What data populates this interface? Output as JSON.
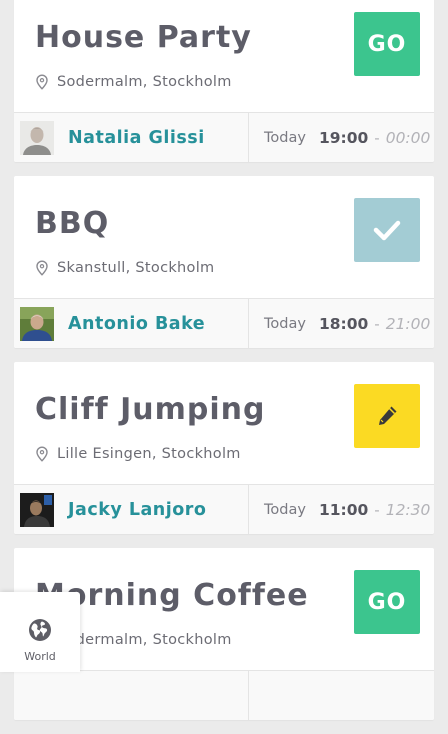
{
  "events": [
    {
      "title": "House Party",
      "location": "Sodermalm, Stockholm",
      "action": "go",
      "action_label": "GO",
      "host": "Natalia Glissi",
      "day": "Today",
      "start": "19:00",
      "separator": "-",
      "end": "00:00"
    },
    {
      "title": "BBQ",
      "location": "Skanstull, Stockholm",
      "action": "done",
      "action_label": "",
      "host": "Antonio Bake",
      "day": "Today",
      "start": "18:00",
      "separator": "-",
      "end": "21:00"
    },
    {
      "title": "Cliff Jumping",
      "location": "Lille Esingen, Stockholm",
      "action": "edit",
      "action_label": "",
      "host": "Jacky Lanjoro",
      "day": "Today",
      "start": "11:00",
      "separator": "-",
      "end": "12:30"
    },
    {
      "title": "Morning Coffee",
      "location": "Sodermalm, Stockholm",
      "action": "go",
      "action_label": "GO",
      "host": "",
      "day": "",
      "start": "",
      "separator": "",
      "end": ""
    }
  ],
  "colors": {
    "go": "#3cc58e",
    "done": "#a3ccd4",
    "edit": "#fbda23",
    "host_name": "#27919a",
    "title": "#5d5d68"
  },
  "icons": {
    "location": "map-pin-icon",
    "done": "checkmark-icon",
    "edit": "pencil-icon",
    "world": "globe-icon"
  },
  "nav": {
    "world_label": "World"
  }
}
